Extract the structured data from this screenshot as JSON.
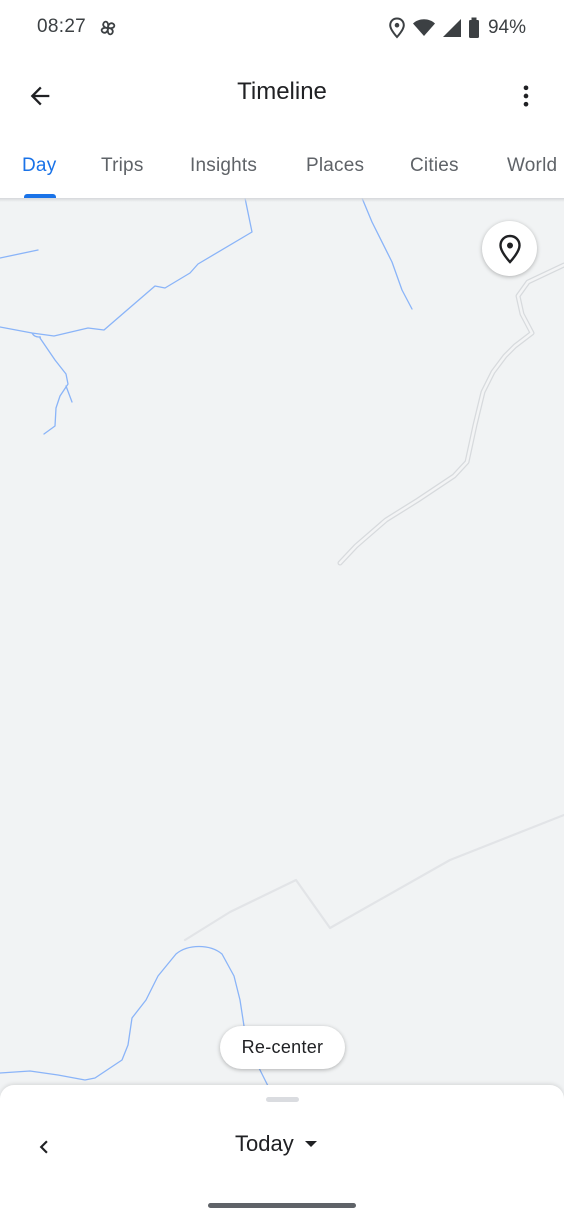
{
  "status_bar": {
    "time": "08:27",
    "battery_percent": "94%",
    "icons": [
      "fan-icon",
      "location-icon",
      "wifi-icon",
      "signal-icon",
      "battery-icon"
    ]
  },
  "app_bar": {
    "title": "Timeline",
    "back_icon": "arrow-back-icon",
    "menu_icon": "more-vert-icon"
  },
  "tabs": [
    {
      "label": "Day",
      "active": true
    },
    {
      "label": "Trips",
      "active": false
    },
    {
      "label": "Insights",
      "active": false
    },
    {
      "label": "Places",
      "active": false
    },
    {
      "label": "Cities",
      "active": false
    },
    {
      "label": "World",
      "active": false
    }
  ],
  "map": {
    "background_color": "#f1f3f4",
    "stream_color": "#8ab4f8",
    "road_color": "#d7dadd",
    "location_button_icon": "location-pin-icon",
    "recenter_label": "Re-center"
  },
  "bottom_sheet": {
    "date_label": "Today",
    "prev_icon": "chevron-left-icon",
    "dropdown_icon": "arrow-drop-down-icon"
  },
  "colors": {
    "accent": "#1a73e8",
    "text_primary": "#202124",
    "text_secondary": "#5f6368"
  }
}
